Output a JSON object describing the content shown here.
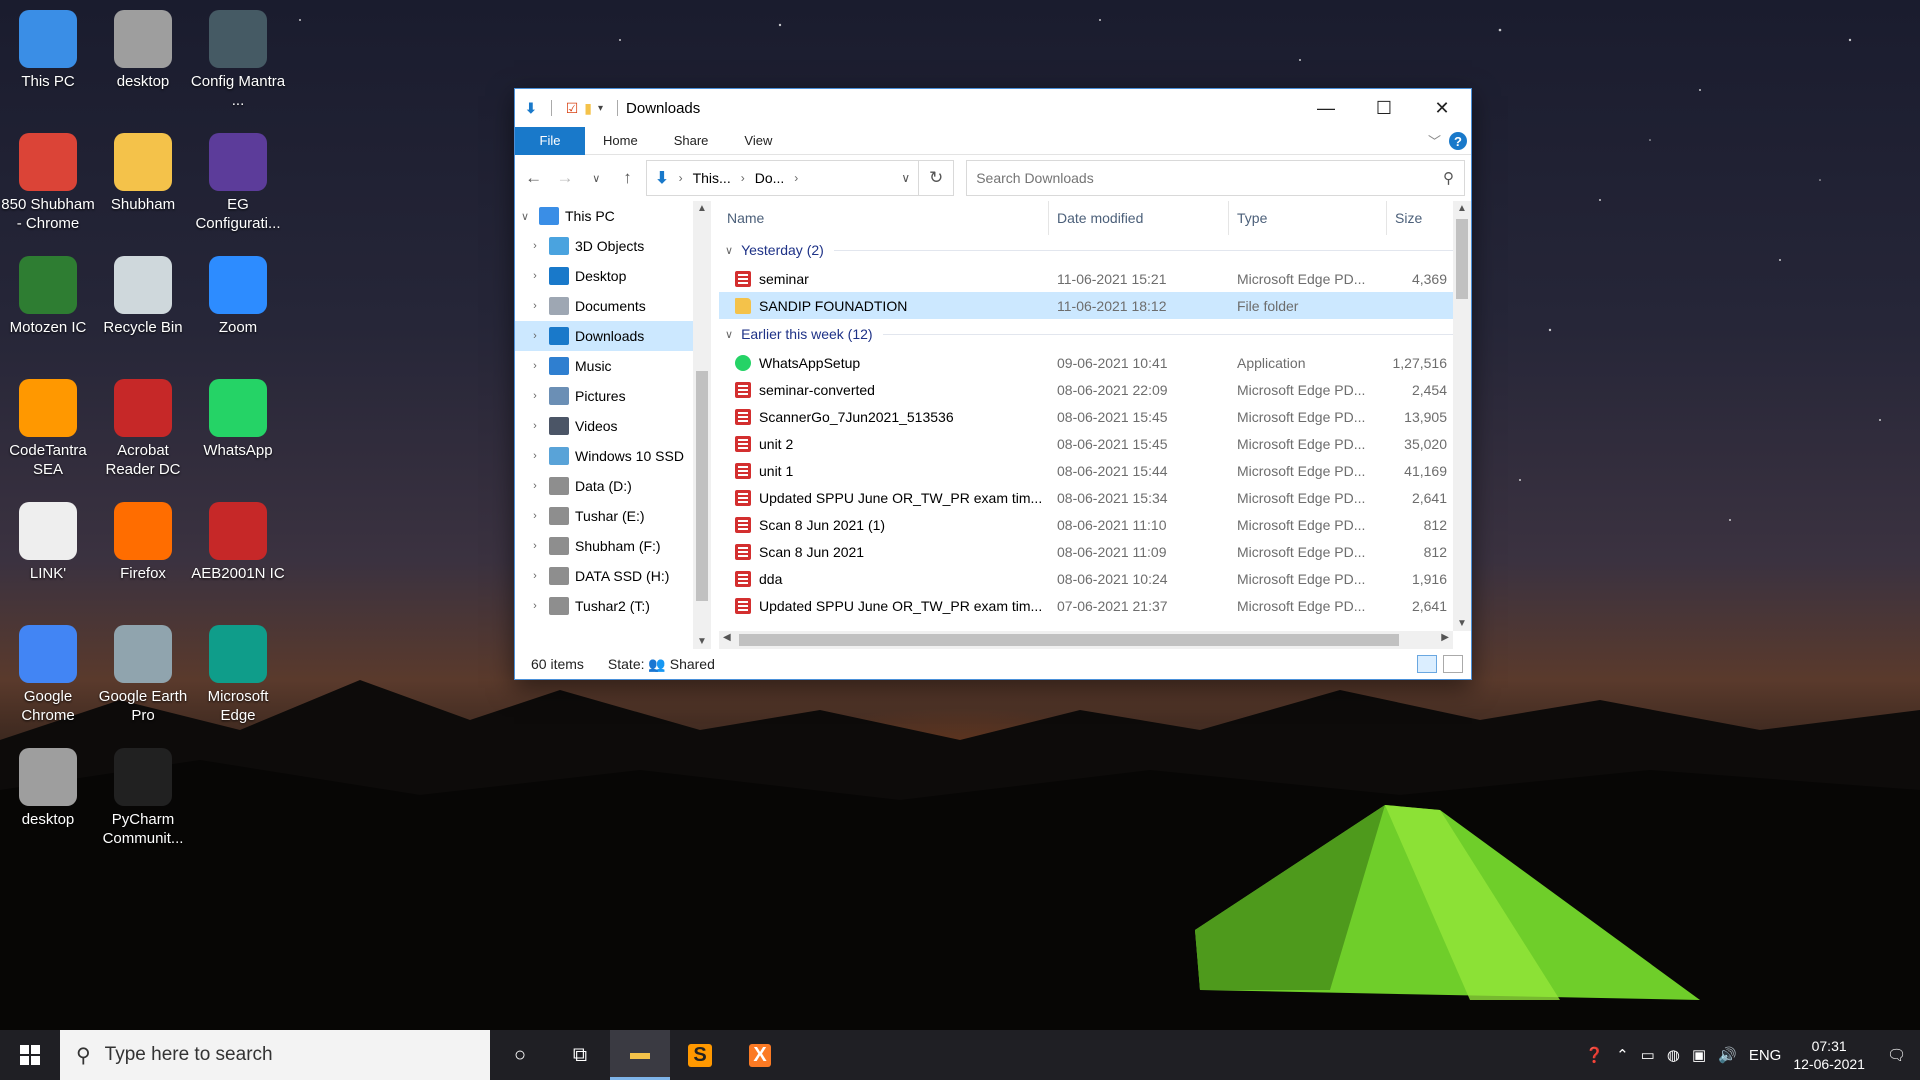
{
  "desktop": {
    "icons": [
      {
        "label": "This PC",
        "color": "#3a8ee6"
      },
      {
        "label": "desktop",
        "color": "#9e9e9e"
      },
      {
        "label": "Config Mantra ...",
        "color": "#455a64"
      },
      {
        "label": "850 Shubham - Chrome",
        "color": "#db4437"
      },
      {
        "label": "Shubham",
        "color": "#f4c24a"
      },
      {
        "label": "EG Configurati...",
        "color": "#5c3c9a"
      },
      {
        "label": "Motozen IC",
        "color": "#2e7d32"
      },
      {
        "label": "Recycle Bin",
        "color": "#cfd8dc"
      },
      {
        "label": "Zoom",
        "color": "#2d8cff"
      },
      {
        "label": "CodeTantra SEA",
        "color": "#ff9800"
      },
      {
        "label": "Acrobat Reader DC",
        "color": "#c62828"
      },
      {
        "label": "WhatsApp",
        "color": "#25d366"
      },
      {
        "label": "LINK'",
        "color": "#eeeeee"
      },
      {
        "label": "Firefox",
        "color": "#ff6d00"
      },
      {
        "label": "AEB2001N IC",
        "color": "#c62828"
      },
      {
        "label": "Google Chrome",
        "color": "#4285f4"
      },
      {
        "label": "Google Earth Pro",
        "color": "#90a4ae"
      },
      {
        "label": "Microsoft Edge",
        "color": "#0f9d8a"
      },
      {
        "label": "desktop",
        "color": "#9e9e9e"
      },
      {
        "label": "PyCharm Communit...",
        "color": "#212121"
      }
    ]
  },
  "window": {
    "title": "Downloads",
    "ribbon_tabs": {
      "file": "File",
      "home": "Home",
      "share": "Share",
      "view": "View"
    },
    "address": {
      "crumb1": "This...",
      "crumb2": "Do..."
    },
    "search": {
      "placeholder": "Search Downloads"
    },
    "nav_items": [
      {
        "label": "This PC",
        "color": "#3a8ee6"
      },
      {
        "label": "3D Objects",
        "color": "#4aa3df"
      },
      {
        "label": "Desktop",
        "color": "#1979ca"
      },
      {
        "label": "Documents",
        "color": "#9ea7b3"
      },
      {
        "label": "Downloads",
        "color": "#1979ca"
      },
      {
        "label": "Music",
        "color": "#2f7fd0"
      },
      {
        "label": "Pictures",
        "color": "#6b8fb5"
      },
      {
        "label": "Videos",
        "color": "#4b5566"
      },
      {
        "label": "Windows 10 SSD",
        "color": "#59a3d8"
      },
      {
        "label": "Data (D:)",
        "color": "#8e8e8e"
      },
      {
        "label": "Tushar (E:)",
        "color": "#8e8e8e"
      },
      {
        "label": "Shubham (F:)",
        "color": "#8e8e8e"
      },
      {
        "label": "DATA SSD (H:)",
        "color": "#8e8e8e"
      },
      {
        "label": "Tushar2 (T:)",
        "color": "#8e8e8e"
      }
    ],
    "columns": {
      "name": "Name",
      "date": "Date modified",
      "type": "Type",
      "size": "Size"
    },
    "group1": {
      "label": "Yesterday (2)",
      "rows": [
        {
          "name": "seminar",
          "date": "11-06-2021 15:21",
          "type": "Microsoft Edge PD...",
          "size": "4,369",
          "icon": "pdf"
        },
        {
          "name": "SANDIP FOUNADTION",
          "date": "11-06-2021 18:12",
          "type": "File folder",
          "size": "",
          "icon": "folder"
        }
      ]
    },
    "group2": {
      "label": "Earlier this week (12)",
      "rows": [
        {
          "name": "WhatsAppSetup",
          "date": "09-06-2021 10:41",
          "type": "Application",
          "size": "1,27,516",
          "icon": "wa"
        },
        {
          "name": "seminar-converted",
          "date": "08-06-2021 22:09",
          "type": "Microsoft Edge PD...",
          "size": "2,454",
          "icon": "pdf"
        },
        {
          "name": "ScannerGo_7Jun2021_513536",
          "date": "08-06-2021 15:45",
          "type": "Microsoft Edge PD...",
          "size": "13,905",
          "icon": "pdf"
        },
        {
          "name": "unit 2",
          "date": "08-06-2021 15:45",
          "type": "Microsoft Edge PD...",
          "size": "35,020",
          "icon": "pdf"
        },
        {
          "name": "unit 1",
          "date": "08-06-2021 15:44",
          "type": "Microsoft Edge PD...",
          "size": "41,169",
          "icon": "pdf"
        },
        {
          "name": "Updated SPPU June OR_TW_PR exam tim...",
          "date": "08-06-2021 15:34",
          "type": "Microsoft Edge PD...",
          "size": "2,641",
          "icon": "pdf"
        },
        {
          "name": "Scan 8 Jun 2021 (1)",
          "date": "08-06-2021 11:10",
          "type": "Microsoft Edge PD...",
          "size": "812",
          "icon": "pdf"
        },
        {
          "name": "Scan 8 Jun 2021",
          "date": "08-06-2021 11:09",
          "type": "Microsoft Edge PD...",
          "size": "812",
          "icon": "pdf"
        },
        {
          "name": "dda",
          "date": "08-06-2021 10:24",
          "type": "Microsoft Edge PD...",
          "size": "1,916",
          "icon": "pdf"
        },
        {
          "name": "Updated SPPU June OR_TW_PR exam tim...",
          "date": "07-06-2021 21:37",
          "type": "Microsoft Edge PD...",
          "size": "2,641",
          "icon": "pdf"
        }
      ]
    },
    "status": {
      "items": "60 items",
      "state_label": "State:",
      "state_value": "Shared"
    }
  },
  "taskbar": {
    "search_placeholder": "Type here to search",
    "language": "ENG",
    "time": "07:31",
    "date": "12-06-2021"
  }
}
